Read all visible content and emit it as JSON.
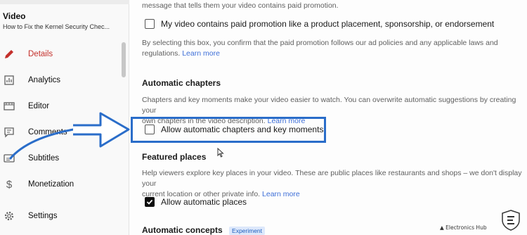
{
  "sidebar": {
    "heading": "Video",
    "video_title": "How to Fix the Kernel Security Chec...",
    "items": [
      {
        "label": "Details",
        "icon": "pencil-icon"
      },
      {
        "label": "Analytics",
        "icon": "analytics-icon"
      },
      {
        "label": "Editor",
        "icon": "editor-icon"
      },
      {
        "label": "Comments",
        "icon": "comments-icon"
      },
      {
        "label": "Subtitles",
        "icon": "subtitles-icon"
      },
      {
        "label": "Monetization",
        "icon": "dollar-icon"
      },
      {
        "label": "Settings",
        "icon": "gear-icon"
      }
    ]
  },
  "paid_promotion": {
    "top_text": "message that tells them your video contains paid promotion.",
    "checkbox_label": "My video contains paid promotion like a product placement, sponsorship, or endorsement",
    "checked": false,
    "disclaimer_line1": "By selecting this box, you confirm that the paid promotion follows our ad policies and any applicable laws and",
    "disclaimer_line2": "regulations.",
    "learn_more": "Learn more"
  },
  "automatic_chapters": {
    "heading": "Automatic chapters",
    "desc_line1": "Chapters and key moments make your video easier to watch. You can overwrite automatic suggestions by creating your",
    "desc_line2": "own chapters in the video description.",
    "learn_more": "Learn more",
    "checkbox_label": "Allow automatic chapters and key moments",
    "checked": false
  },
  "featured_places": {
    "heading": "Featured places",
    "desc_line1": "Help viewers explore key places in your video. These are public places like restaurants and shops – we don't display your",
    "desc_line2": "current location or other private info.",
    "learn_more": "Learn more",
    "checkbox_label": "Allow automatic places",
    "checked": true
  },
  "automatic_concepts": {
    "heading": "Automatic concepts",
    "badge": "Experiment"
  },
  "watermark": {
    "text": "Electronics Hub"
  },
  "colors": {
    "active": "#c4302b",
    "link": "#3e6fd8",
    "highlight": "#2a6dc9"
  }
}
